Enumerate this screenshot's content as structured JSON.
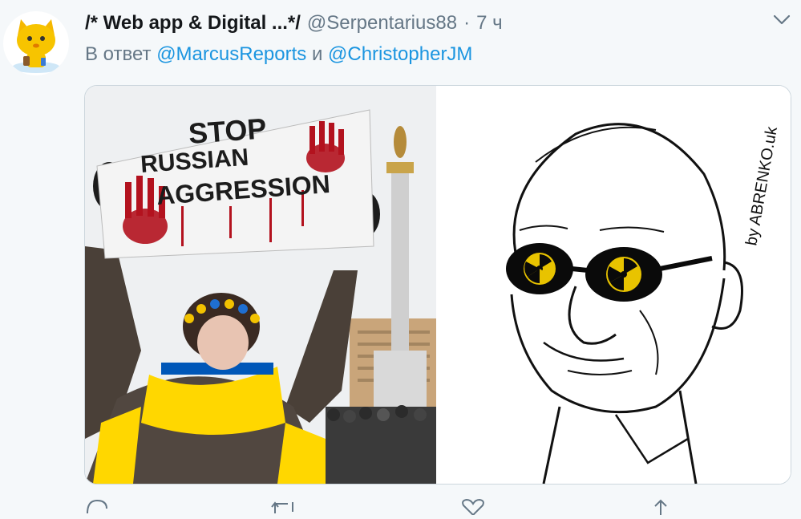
{
  "tweet": {
    "display_name": "/* Web app & Digital ...*/",
    "handle": "@Serpentarius88",
    "separator": "·",
    "time": "7 ч",
    "reply_prefix": "В ответ",
    "reply_conjunction": "и",
    "mention_1": "@MarcusReports",
    "mention_2": "@ChristopherJM"
  },
  "media": {
    "sign_line_1": "STOP",
    "sign_line_2": "RUSSIAN",
    "sign_line_3": "AGGRESSION",
    "signature": "by ABRENKO.uk"
  },
  "colors": {
    "link": "#1b95e0",
    "secondary": "#657786",
    "text": "#14171a",
    "background": "#f5f8fa",
    "border": "#ccd6dd",
    "flag_blue": "#0057b8",
    "flag_yellow": "#ffd700",
    "blood_red": "#b3121e"
  },
  "icons": {
    "avatar": "yellow-cat-avatar",
    "menu": "chevron-down-icon",
    "reply": "reply-icon",
    "retweet": "retweet-icon",
    "like": "heart-icon",
    "share": "share-icon"
  }
}
